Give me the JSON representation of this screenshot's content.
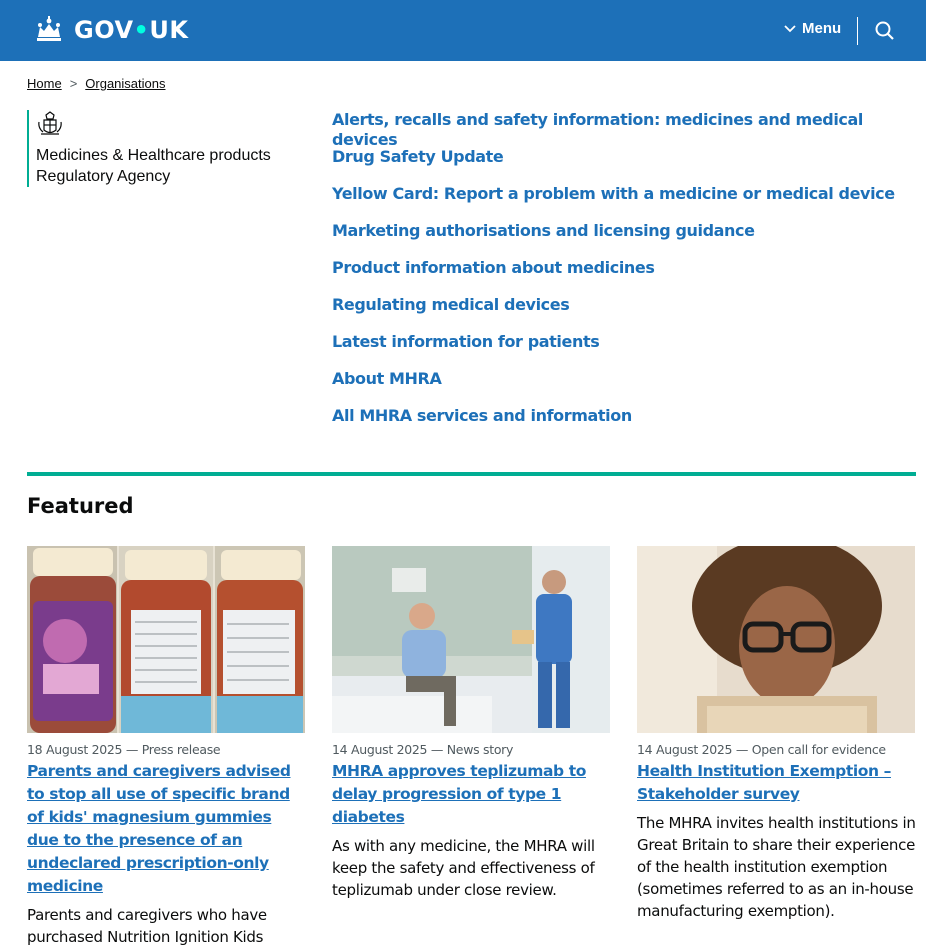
{
  "header": {
    "logo_text_gov": "GOV",
    "logo_dot": "•",
    "logo_text_uk": "UK",
    "menu_label": "Menu",
    "brand_color": "#1d70b8",
    "accent_color": "#00ffe0"
  },
  "breadcrumb": [
    {
      "label": "Home"
    },
    {
      "label": "Organisations"
    }
  ],
  "organisation": {
    "name_line1": "Medicines & Healthcare products",
    "name_line2": "Regulatory Agency",
    "accent_color": "#00ad93"
  },
  "quick_links": [
    {
      "label": "Alerts, recalls and safety information: medicines and medical devices"
    },
    {
      "label": "Drug Safety Update"
    },
    {
      "label": "Yellow Card: Report a problem with a medicine or medical device"
    },
    {
      "label": "Marketing authorisations and licensing guidance"
    },
    {
      "label": "Product information about medicines"
    },
    {
      "label": "Regulating medical devices"
    },
    {
      "label": "Latest information for patients"
    },
    {
      "label": "About MHRA"
    },
    {
      "label": "All MHRA services and information"
    }
  ],
  "featured": {
    "title": "Featured",
    "items": [
      {
        "meta": "18 August 2025 — Press release",
        "title": "Parents and caregivers advised to stop all use of specific brand of kids' magnesium gummies due to the presence of an undeclared prescription-only medicine",
        "description": "Parents and caregivers who have purchased Nutrition Ignition Kids Magnesium Glycinate Gummies",
        "image": "magnesium-gummies-bottles-photo"
      },
      {
        "meta": "14 August 2025 — News story",
        "title": "MHRA approves teplizumab to delay progression of type 1 diabetes",
        "description": "As with any medicine, the MHRA will keep the safety and effectiveness of teplizumab under close review.",
        "image": "patient-and-clinician-photo"
      },
      {
        "meta": "14 August 2025 — Open call for evidence",
        "title": "Health Institution Exemption – Stakeholder survey",
        "description": "The MHRA invites health institutions in Great Britain to share their experience of the health institution exemption (sometimes referred to as an in-house manufacturing exemption).",
        "image": "woman-with-glasses-photo"
      }
    ]
  }
}
